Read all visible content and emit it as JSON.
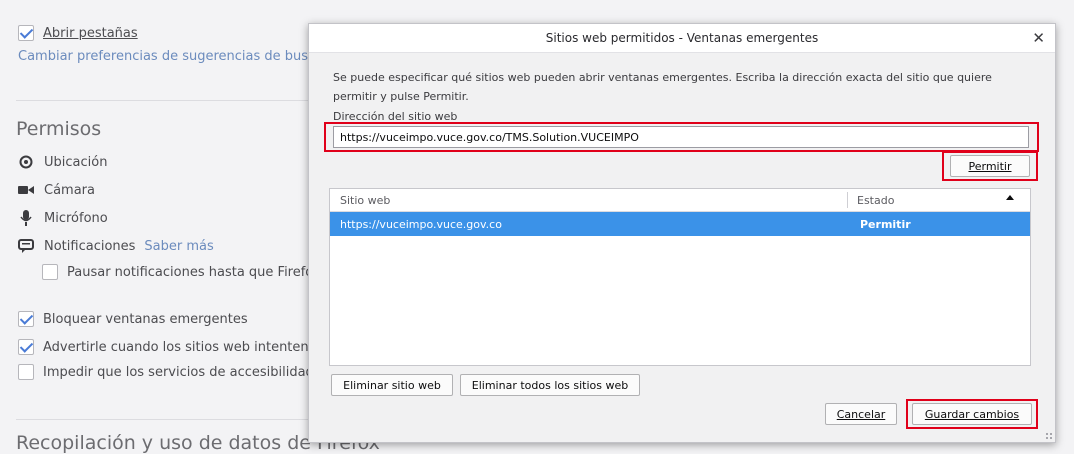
{
  "prefs": {
    "open_tabs": "Abrir pestañas",
    "suggest_link": "Cambiar preferencias de sugerencias de busca",
    "permissions_heading": "Permisos",
    "location": "Ubicación",
    "camera": "Cámara",
    "microphone": "Micrófono",
    "notifications": "Notificaciones",
    "learn_more": "Saber más",
    "pause_notifications": "Pausar notificaciones hasta que Firefo",
    "block_popups": "Bloquear ventanas emergentes",
    "warn_addons": "Advertirle cuando los sitios web intenten i",
    "accessibility": "Impedir que los servicios de accesibilidad",
    "data_collection_heading": "Recopilación y uso de datos de Firefox",
    "checked": {
      "open_tabs": true,
      "pause_notifications": false,
      "block_popups": true,
      "warn_addons": true,
      "accessibility": false
    }
  },
  "dialog": {
    "title": "Sitios web permitidos - Ventanas emergentes",
    "close_symbol": "✕",
    "description": "Se puede especificar qué sitios web pueden abrir ventanas emergentes. Escriba la dirección exacta del sitio que quiere permitir y pulse Permitir.",
    "address_label": "Dirección del sitio web",
    "address_value": "https://vuceimpo.vuce.gov.co/TMS.Solution.VUCEIMPO",
    "allow_button": "Permitir",
    "columns": [
      "Sitio web",
      "Estado"
    ],
    "rows": [
      {
        "site": "https://vuceimpo.vuce.gov.co",
        "status": "Permitir",
        "selected": true
      }
    ],
    "remove_site_button": "Eliminar sitio web",
    "remove_all_button": "Eliminar todos los sitios web",
    "cancel_button": "Cancelar",
    "save_button": "Guardar cambios"
  },
  "colors": {
    "selection": "#3b92e8",
    "highlight_box": "#e0001a",
    "checkbox_accent": "#4a7bd6"
  }
}
